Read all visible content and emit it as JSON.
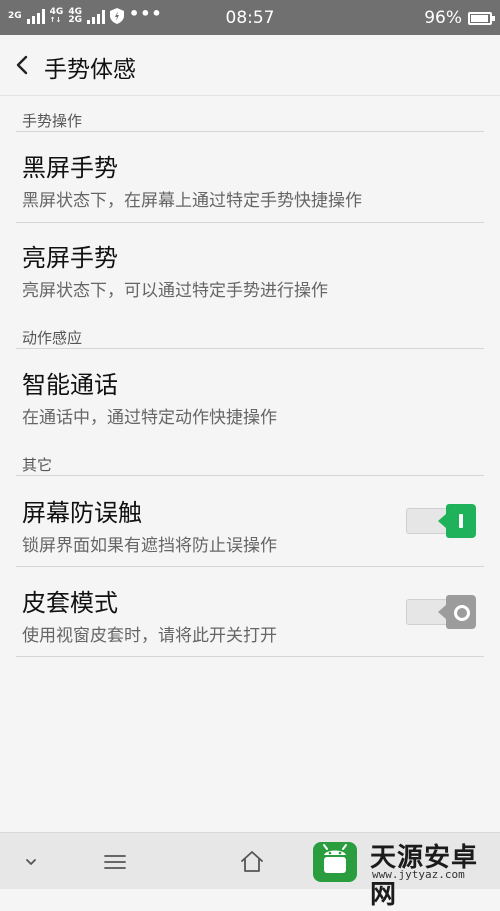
{
  "status_bar": {
    "network_left": "2G",
    "network_mid1": "4G",
    "network_mid2": "4G",
    "network_mid3": "2G",
    "time": "08:57",
    "battery_percent": "96%",
    "battery_level": 0.96
  },
  "header": {
    "title": "手势体感"
  },
  "sections": {
    "gesture": {
      "title": "手势操作"
    },
    "motion": {
      "title": "动作感应"
    },
    "other": {
      "title": "其它"
    }
  },
  "items": {
    "black_screen": {
      "title": "黑屏手势",
      "subtitle": "黑屏状态下，在屏幕上通过特定手势快捷操作"
    },
    "bright_screen": {
      "title": "亮屏手势",
      "subtitle": "亮屏状态下，可以通过特定手势进行操作"
    },
    "smart_call": {
      "title": "智能通话",
      "subtitle": "在通话中，通过特定动作快捷操作"
    },
    "anti_touch": {
      "title": "屏幕防误触",
      "subtitle": "锁屏界面如果有遮挡将防止误操作",
      "enabled": true
    },
    "cover_mode": {
      "title": "皮套模式",
      "subtitle": "使用视窗皮套时，请将此开关打开",
      "enabled": false
    }
  },
  "colors": {
    "toggle_on": "#20b25a",
    "toggle_off": "#9c9c9c",
    "status_bar": "#707070"
  },
  "watermark": {
    "title": "天源安卓网",
    "url": "www.jytyaz.com"
  }
}
